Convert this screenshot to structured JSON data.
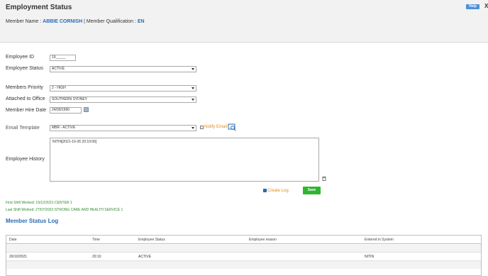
{
  "header": {
    "title": "Employment Status",
    "help_label": "Help",
    "close_label": "X"
  },
  "member": {
    "name_label": "Member Name :",
    "name_value": "ABBIE CORNISH",
    "separator": "|",
    "qual_label": "Member Qualification :",
    "qual_value": "EN"
  },
  "form": {
    "employee_id_label": "Employee ID",
    "employee_id_value": "19_____",
    "employee_status_label": "Employee Status",
    "employee_status_value": "ACTIVE",
    "priority_label": "Members Priority",
    "priority_value": "2 - HIGH",
    "office_label": "Attached to Office",
    "office_value": "SOUTHERN SYDNEY",
    "hire_date_label": "Member Hire Date",
    "hire_date_value": "24/09/1990",
    "email_template_label": "Email Template",
    "email_template_value": "MBR - ACTIVE",
    "notify_email_label": "Notify Email",
    "history_label": "Employee History",
    "history_value": "NITIN[2021-10-26 20:10:06]",
    "create_log_label": "Create Log",
    "create_log_checked": true,
    "save_label": "Save"
  },
  "shifts": {
    "first": "First Shift Worked: 15/12/2021-CENTER 1",
    "last": "Last Shift Worked: 27/07/2022-STRONG CARE AND HEALTH SERVICE 1"
  },
  "status_log": {
    "title": "Member Status Log",
    "columns": [
      "Date",
      "Time",
      "Employee Status",
      "Employee reason",
      "Entered in System"
    ],
    "rows": [
      [
        "26/10/2021",
        "20:10",
        "ACTIVE",
        "",
        "NITIN"
      ]
    ]
  },
  "colors": {
    "accent_blue": "#2a6bb5",
    "save_green": "#2fb52f",
    "orange_label": "#e08a1e",
    "shift_green": "#2d8a2d"
  }
}
